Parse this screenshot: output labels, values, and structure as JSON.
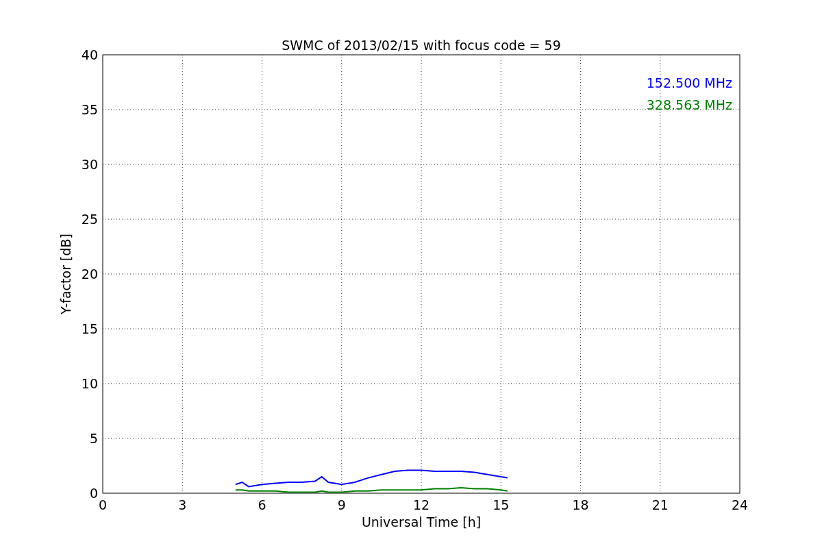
{
  "chart_data": {
    "type": "line",
    "title": "SWMC of 2013/02/15 with focus code = 59",
    "xlabel": "Universal Time [h]",
    "ylabel": "Y-factor [dB]",
    "x": [
      5,
      5.25,
      5.5,
      6,
      6.5,
      7,
      7.5,
      8,
      8.25,
      8.5,
      9,
      9.5,
      10,
      10.5,
      11,
      11.5,
      12,
      12.5,
      13,
      13.5,
      14,
      14.5,
      15,
      15.25
    ],
    "series": [
      {
        "name": "152.500 MHz",
        "color": "#0000ff",
        "values": [
          0.8,
          1.0,
          0.6,
          0.8,
          0.9,
          1.0,
          1.0,
          1.1,
          1.5,
          1.0,
          0.8,
          1.0,
          1.4,
          1.7,
          2.0,
          2.1,
          2.1,
          2.0,
          2.0,
          2.0,
          1.9,
          1.7,
          1.5,
          1.4
        ]
      },
      {
        "name": "328.563 MHz",
        "color": "#008000",
        "values": [
          0.3,
          0.3,
          0.2,
          0.2,
          0.2,
          0.1,
          0.1,
          0.1,
          0.2,
          0.1,
          0.1,
          0.2,
          0.2,
          0.3,
          0.3,
          0.3,
          0.3,
          0.4,
          0.4,
          0.5,
          0.4,
          0.4,
          0.3,
          0.2
        ]
      }
    ],
    "grid": true,
    "xlim": [
      0,
      24
    ],
    "ylim": [
      0,
      40
    ],
    "xticks": [
      0,
      3,
      6,
      9,
      12,
      15,
      18,
      21,
      24
    ],
    "yticks": [
      0,
      5,
      10,
      15,
      20,
      25,
      30,
      35,
      40
    ]
  }
}
